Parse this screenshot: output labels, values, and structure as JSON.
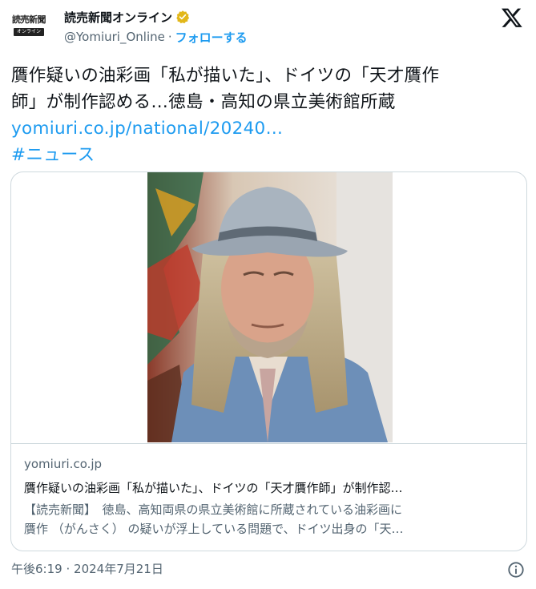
{
  "account": {
    "display_name": "読売新聞オンライン",
    "handle": "@Yomiuri_Online",
    "separator": "·",
    "follow_label": "フォローする",
    "avatar_text_top": "読売新聞",
    "avatar_text_bottom": "オンライン",
    "badge_color": "#e2b719"
  },
  "tweet": {
    "text_lines": [
      "贋作疑いの油彩画「私が描いた」、ドイツの「天才贋作",
      "師」が制作認める…徳島・高知の県立美術館所蔵"
    ],
    "link": "yomiuri.co.jp/national/20240…",
    "hashtag": "#ニュース"
  },
  "card": {
    "domain": "yomiuri.co.jp",
    "title": "贋作疑いの油彩画「私が描いた」、ドイツの「天才贋作師」が制作認…",
    "description_lines": [
      "【読売新聞】　徳島、高知両県の県立美術館に所蔵されている油彩画に",
      "贋作 （がんさく） の疑いが浮上している問題で、ドイツ出身の「天…"
    ]
  },
  "meta": {
    "time": "午後6:19",
    "separator": "·",
    "date": "2024年7月21日"
  },
  "icons": {
    "x_logo": "x-logo-icon",
    "info": "info-icon",
    "verified": "verified-badge-icon"
  },
  "colors": {
    "link": "#1d9bf0",
    "secondary_text": "#536471",
    "border": "#cfd9de"
  }
}
